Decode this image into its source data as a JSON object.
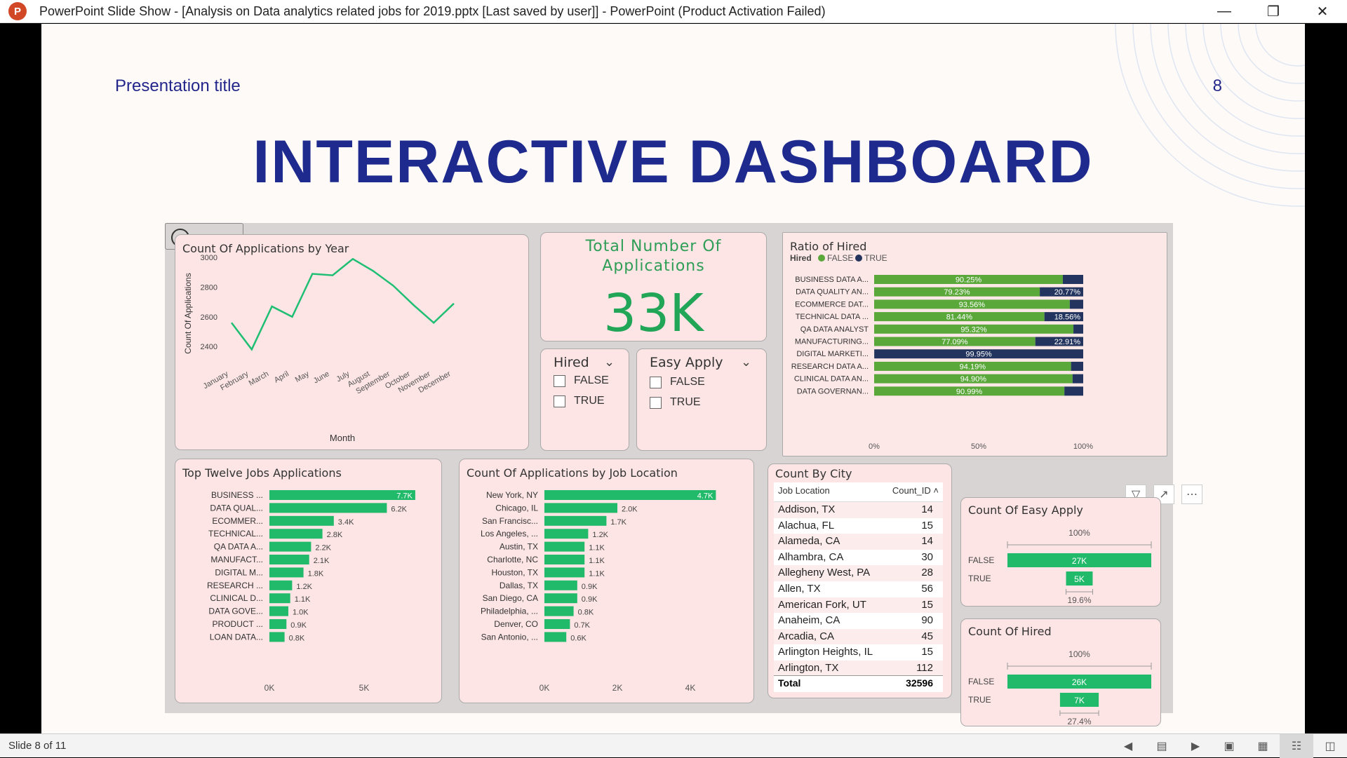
{
  "window": {
    "title": "PowerPoint Slide Show - [Analysis on Data analytics related jobs for 2019.pptx [Last saved by user]] - PowerPoint (Product Activation Failed)",
    "app_icon": "powerpoint-icon"
  },
  "slide": {
    "presentation_title": "Presentation title",
    "slide_number": "8",
    "main_title": "INTERACTIVE DASHBOARD"
  },
  "status_bar": {
    "slide_indicator": "Slide 8 of 11"
  },
  "kpi": {
    "title": "Total Number Of Applications",
    "value": "33K"
  },
  "slicers": {
    "hired": {
      "title": "Hired",
      "options": [
        "FALSE",
        "TRUE"
      ]
    },
    "easy_apply": {
      "title": "Easy Apply",
      "options": [
        "FALSE",
        "TRUE"
      ]
    }
  },
  "city_table": {
    "title": "Count By City",
    "headers": [
      "Job Location",
      "Count_ID"
    ],
    "rows": [
      [
        "Addison, TX",
        "14"
      ],
      [
        "Alachua, FL",
        "15"
      ],
      [
        "Alameda, CA",
        "14"
      ],
      [
        "Alhambra, CA",
        "30"
      ],
      [
        "Allegheny West, PA",
        "28"
      ],
      [
        "Allen, TX",
        "56"
      ],
      [
        "American Fork, UT",
        "15"
      ],
      [
        "Anaheim, CA",
        "90"
      ],
      [
        "Arcadia, CA",
        "45"
      ],
      [
        "Arlington Heights, IL",
        "15"
      ],
      [
        "Arlington, TX",
        "112"
      ]
    ],
    "total_label": "Total",
    "total_value": "32596"
  },
  "colors": {
    "green": "#21b96a",
    "bar_green": "#5aa83a",
    "navy": "#23345e",
    "title_blue": "#1e2a8e",
    "card_pink": "#fde5e5"
  },
  "chart_data": [
    {
      "id": "line",
      "type": "line",
      "title": "Count Of Applications by Year",
      "xlabel": "Month",
      "ylabel": "Count Of Applications",
      "categories": [
        "January",
        "February",
        "March",
        "April",
        "May",
        "June",
        "July",
        "August",
        "September",
        "October",
        "November",
        "December"
      ],
      "values": [
        2560,
        2380,
        2670,
        2600,
        2890,
        2880,
        2990,
        2910,
        2810,
        2680,
        2560,
        2690
      ],
      "yticks": [
        2400,
        2600,
        2800,
        3000
      ],
      "ylim": [
        2320,
        3020
      ],
      "grid": false
    },
    {
      "id": "ratio",
      "type": "bar",
      "title": "Ratio of Hired",
      "legend_title": "Hired",
      "legend_position": "top-left",
      "categories": [
        "BUSINESS DATA A...",
        "DATA QUALITY AN...",
        "ECOMMERCE DAT...",
        "TECHNICAL DATA ...",
        "QA DATA ANALYST",
        "MANUFACTURING...",
        "DIGITAL MARKETI...",
        "RESEARCH DATA A...",
        "CLINICAL DATA AN...",
        "DATA GOVERNAN..."
      ],
      "series": [
        {
          "name": "FALSE",
          "values": [
            90.25,
            79.23,
            93.56,
            81.44,
            95.32,
            77.09,
            0.05,
            94.19,
            94.9,
            90.99
          ],
          "labels": [
            "90.25%",
            "79.23%",
            "93.56%",
            "81.44%",
            "95.32%",
            "77.09%",
            "",
            "94.19%",
            "94.90%",
            "90.99%"
          ]
        },
        {
          "name": "TRUE",
          "values": [
            9.75,
            20.77,
            6.44,
            18.56,
            4.68,
            22.91,
            99.95,
            5.81,
            5.1,
            9.01
          ],
          "labels": [
            "",
            "20.77%",
            "",
            "18.56%",
            "",
            "22.91%",
            "99.95%",
            "",
            "",
            ""
          ]
        }
      ],
      "xticks": [
        "0%",
        "50%",
        "100%"
      ],
      "xlim": [
        0,
        100
      ]
    },
    {
      "id": "jobs",
      "type": "bar",
      "title": "Top Twelve Jobs Applications",
      "categories": [
        "BUSINESS ...",
        "DATA QUAL...",
        "ECOMMER...",
        "TECHNICAL...",
        "QA DATA A...",
        "MANUFACT...",
        "DIGITAL M...",
        "RESEARCH ...",
        "CLINICAL D...",
        "DATA GOVE...",
        "PRODUCT ...",
        "LOAN DATA..."
      ],
      "values": [
        7700,
        6200,
        3400,
        2800,
        2200,
        2100,
        1800,
        1200,
        1100,
        1000,
        900,
        800
      ],
      "labels": [
        "7.7K",
        "6.2K",
        "3.4K",
        "2.8K",
        "2.2K",
        "2.1K",
        "1.8K",
        "1.2K",
        "1.1K",
        "1.0K",
        "0.9K",
        "0.8K"
      ],
      "xticks": [
        {
          "v": 0,
          "t": "0K"
        },
        {
          "v": 5000,
          "t": "5K"
        }
      ],
      "xlim": [
        0,
        8000
      ]
    },
    {
      "id": "locations",
      "type": "bar",
      "title": "Count Of Applications by Job Location",
      "categories": [
        "New York, NY",
        "Chicago, IL",
        "San Francisc...",
        "Los Angeles, ...",
        "Austin, TX",
        "Charlotte, NC",
        "Houston, TX",
        "Dallas, TX",
        "San Diego, CA",
        "Philadelphia, ...",
        "Denver, CO",
        "San Antonio, ..."
      ],
      "values": [
        4700,
        2000,
        1700,
        1200,
        1100,
        1100,
        1100,
        900,
        900,
        800,
        700,
        600
      ],
      "labels": [
        "4.7K",
        "2.0K",
        "1.7K",
        "1.2K",
        "1.1K",
        "1.1K",
        "1.1K",
        "0.9K",
        "0.9K",
        "0.8K",
        "0.7K",
        "0.6K"
      ],
      "xticks": [
        {
          "v": 0,
          "t": "0K"
        },
        {
          "v": 2000,
          "t": "2K"
        },
        {
          "v": 4000,
          "t": "4K"
        }
      ],
      "xlim": [
        0,
        5000
      ]
    },
    {
      "id": "easyapply",
      "type": "bar",
      "title": "Count Of Easy Apply",
      "categories": [
        "FALSE",
        "TRUE"
      ],
      "values": [
        27,
        5
      ],
      "labels": [
        "27K",
        "5K"
      ],
      "top_label": "100%",
      "bottom_label": "19.6%"
    },
    {
      "id": "hiredcount",
      "type": "bar",
      "title": "Count Of Hired",
      "categories": [
        "FALSE",
        "TRUE"
      ],
      "values": [
        26,
        7
      ],
      "labels": [
        "26K",
        "7K"
      ],
      "top_label": "100%",
      "bottom_label": "27.4%"
    }
  ]
}
